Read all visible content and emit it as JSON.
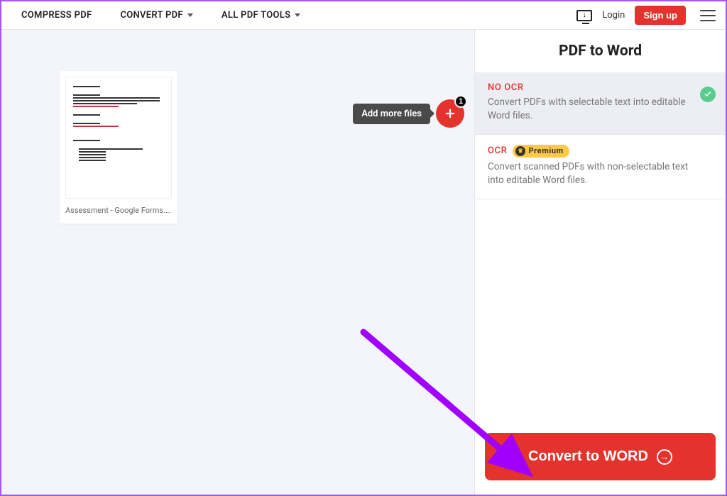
{
  "header": {
    "nav": {
      "compress": "COMPRESS PDF",
      "convert": "CONVERT PDF",
      "all_tools": "ALL PDF TOOLS"
    },
    "login": "Login",
    "signup": "Sign up"
  },
  "workspace": {
    "add_more_tooltip": "Add more files",
    "file_count_badge": "1",
    "files": [
      {
        "name": "Assessment - Google Forms.pdf"
      }
    ]
  },
  "sidebar": {
    "title": "PDF to Word",
    "options": [
      {
        "id": "no_ocr",
        "title": "NO OCR",
        "desc": "Convert PDFs with selectable text into editable Word files.",
        "selected": true,
        "premium": false
      },
      {
        "id": "ocr",
        "title": "OCR",
        "desc": "Convert scanned PDFs with non-selectable text into editable Word files.",
        "selected": false,
        "premium": true,
        "premium_label": "Premium"
      }
    ],
    "convert_label": "Convert to WORD"
  }
}
